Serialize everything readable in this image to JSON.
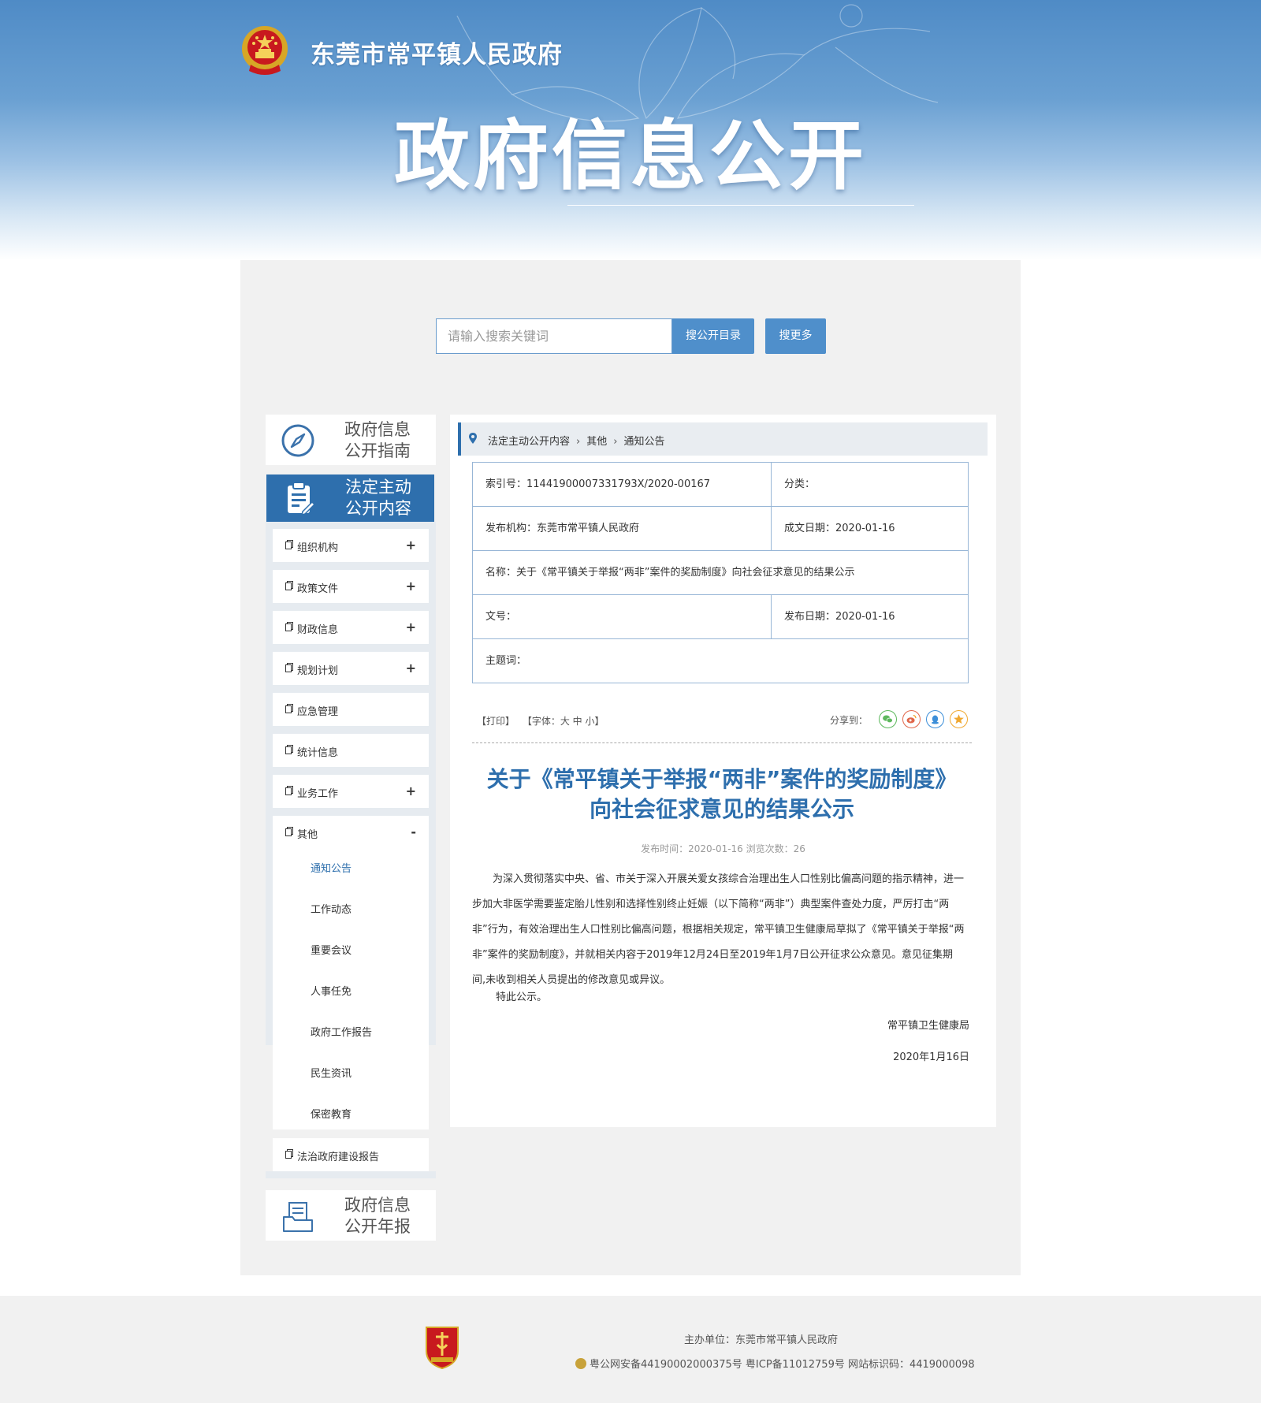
{
  "header": {
    "site_name": "东莞市常平镇人民政府",
    "big_title": "政府信息公开"
  },
  "search": {
    "placeholder": "请输入搜索关键词",
    "button_catalog": "搜公开目录",
    "button_more": "搜更多"
  },
  "sidebar": {
    "guide": {
      "line1": "政府信息",
      "line2": "公开指南",
      "icon": "compass-icon"
    },
    "active": {
      "line1": "法定主动",
      "line2": "公开内容",
      "icon": "clipboard-icon"
    },
    "annual": {
      "line1": "政府信息",
      "line2": "公开年报",
      "icon": "report-icon"
    },
    "items": [
      {
        "label": "组织机构",
        "toggle": "+"
      },
      {
        "label": "政策文件",
        "toggle": "+"
      },
      {
        "label": "财政信息",
        "toggle": "+"
      },
      {
        "label": "规划计划",
        "toggle": "+"
      },
      {
        "label": "应急管理",
        "toggle": ""
      },
      {
        "label": "统计信息",
        "toggle": ""
      },
      {
        "label": "业务工作",
        "toggle": "+"
      },
      {
        "label": "其他",
        "toggle": "-"
      }
    ],
    "sub_items": [
      "通知公告",
      "工作动态",
      "重要会议",
      "人事任免",
      "政府工作报告",
      "民生资讯",
      "保密教育"
    ],
    "last_item": "法治政府建设报告"
  },
  "breadcrumb": [
    "法定主动公开内容",
    "其他",
    "通知公告"
  ],
  "meta": {
    "index_label": "索引号：",
    "index_value": "11441900007331793X/2020-00167",
    "category_label": "分类：",
    "category_value": "",
    "publisher_label": "发布机构：",
    "publisher_value": "东莞市常平镇人民政府",
    "written_date_label": "成文日期：",
    "written_date_value": "2020-01-16",
    "name_label": "名称：",
    "name_value": "关于《常平镇关于举报“两非”案件的奖励制度》向社会征求意见的结果公示",
    "doc_no_label": "文号：",
    "doc_no_value": "",
    "publish_date_label": "发布日期：",
    "publish_date_value": "2020-01-16",
    "keywords_label": "主题词：",
    "keywords_value": ""
  },
  "tools": {
    "print": "【打印】",
    "font": "【字体：大  中  小】",
    "share_label": "分享到：",
    "share_icons": [
      "wechat-icon",
      "weibo-icon",
      "qq-icon",
      "qzone-icon"
    ]
  },
  "article": {
    "title_line1": "关于《常平镇关于举报“两非”案件的奖励制度》",
    "title_line2": "向社会征求意见的结果公示",
    "meta": "发布时间：2020-01-16  浏览次数：26",
    "body": "为深入贯彻落实中央、省、市关于深入开展关爱女孩综合治理出生人口性别比偏高问题的指示精神，进一步加大非医学需要鉴定胎儿性别和选择性别终止妊娠（以下简称“两非”）典型案件查处力度，严厉打击“两非”行为，有效治理出生人口性别比偏高问题，根据相关规定，常平镇卫生健康局草拟了《常平镇关于举报“两非”案件的奖励制度》，并就相关内容于2019年12月24日至2019年1月7日公开征求公众意见。意见征集期间,未收到相关人员提出的修改意见或异议。",
    "closing": "特此公示。",
    "signature": "常平镇卫生健康局",
    "date": "2020年1月16日"
  },
  "footer": {
    "sponsor": "主办单位：东莞市常平镇人民政府",
    "records": "粤公网安备44190002000375号 粤ICP备11012759号 网站标识码：4419000098"
  },
  "colors": {
    "brand_blue": "#2e6fad",
    "button_blue": "#4f8fcb",
    "panel_gray": "#f1f1f1"
  }
}
